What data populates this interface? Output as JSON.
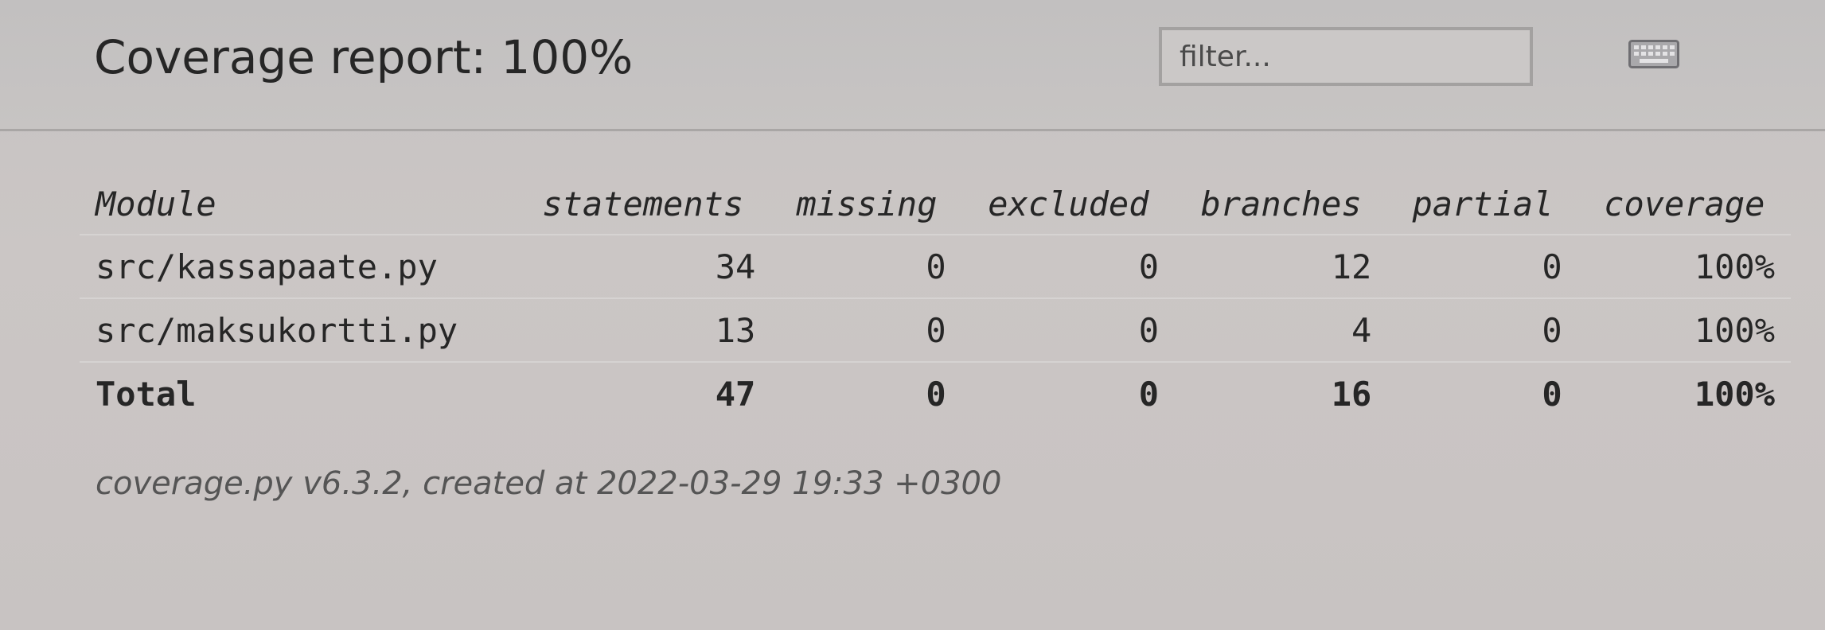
{
  "header": {
    "title": "Coverage report: 100%",
    "filter_placeholder": "filter...",
    "keyboard_icon": "keyboard-icon"
  },
  "table": {
    "columns": [
      "Module",
      "statements",
      "missing",
      "excluded",
      "branches",
      "partial",
      "coverage"
    ],
    "rows": [
      {
        "module": "src/kassapaate.py",
        "statements": "34",
        "missing": "0",
        "excluded": "0",
        "branches": "12",
        "partial": "0",
        "coverage": "100%"
      },
      {
        "module": "src/maksukortti.py",
        "statements": "13",
        "missing": "0",
        "excluded": "0",
        "branches": "4",
        "partial": "0",
        "coverage": "100%"
      }
    ],
    "total": {
      "module": "Total",
      "statements": "47",
      "missing": "0",
      "excluded": "0",
      "branches": "16",
      "partial": "0",
      "coverage": "100%"
    }
  },
  "footer": {
    "text": "coverage.py v6.3.2, created at 2022-03-29 19:33 +0300"
  },
  "colors": {
    "background": "#c8c3c2",
    "text": "#262626",
    "divider": "#a9a6a5"
  }
}
